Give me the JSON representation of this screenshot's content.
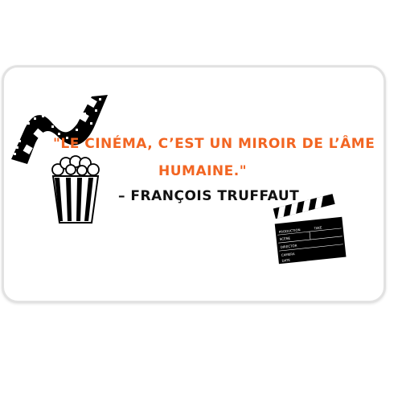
{
  "quote": {
    "line1": "\"LE CINÉMA, C’EST UN MIROIR DE L’ÂME",
    "line2": "HUMAINE.\"",
    "author": "– FRANÇOIS TRUFFAUT"
  },
  "clapperboard": {
    "production_label": "PRODUCTION",
    "take_label": "TAKE",
    "scene_label": "SCENE",
    "director_label": "DIRECTOR",
    "camera_label": "CAMERA",
    "date_label": "DATE"
  },
  "colors": {
    "quote_accent": "#f26522",
    "author": "#111111",
    "icon_black": "#000000"
  },
  "icons": [
    "film-strip-icon",
    "popcorn-icon",
    "clapperboard-icon"
  ]
}
